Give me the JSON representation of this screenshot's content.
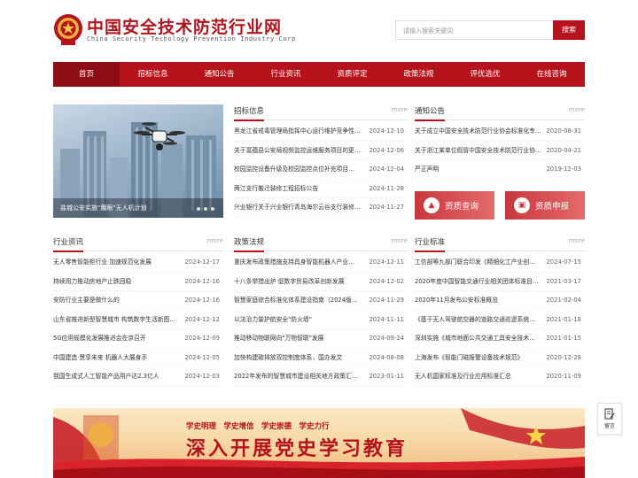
{
  "header": {
    "site_name": "中国安全技术防范行业网",
    "site_name_en": "China Security Techology Prevention Industry Corp",
    "search_placeholder": "请输入搜索关键词",
    "search_button": "搜索"
  },
  "nav": {
    "items": [
      "首页",
      "招标信息",
      "通知公告",
      "行业资讯",
      "资质评定",
      "政策法规",
      "评优选优",
      "在线咨询"
    ]
  },
  "hero": {
    "caption": "盐城公安实施\"鹰眼\"无人机计划"
  },
  "tender": {
    "title": "招标信息",
    "more": "more",
    "items": [
      {
        "title": "黑龙江省戒毒管理局指挥中心运行维护竞争性…",
        "date": "2024-12-10"
      },
      {
        "title": "关于富蕴县公安局视频监控运维服务项目的更…",
        "date": "2024-12-06"
      },
      {
        "title": "校园监控设备升级及校园监控点位补充项目…",
        "date": "2024-12-04"
      },
      {
        "title": "两江支行搬迁装修工程招标公告",
        "date": "2024-11-28"
      },
      {
        "title": "兴业银行关于兴业银行青岛海尔云谷支行装修…",
        "date": "2024-11-27"
      }
    ]
  },
  "notice": {
    "title": "通知公告",
    "more": "more",
    "items": [
      {
        "title": "关于成立中国安全技术防范行业协会标准化专…",
        "date": "2020-08-31"
      },
      {
        "title": "关于浙江某单位假冒中国安全技术防范行业协…",
        "date": "2020-04-21"
      },
      {
        "title": "严正声明",
        "date": "2019-12-03"
      }
    ]
  },
  "qualification": {
    "query": "资质查询",
    "apply": "资质申报"
  },
  "industry": {
    "title": "行业资讯",
    "more": "more",
    "items": [
      {
        "title": "无人零售智能柜行业 加速规范化发展",
        "date": "2024-12-17"
      },
      {
        "title": "持续用力推动房地产止跌回稳",
        "date": "2024-12-16"
      },
      {
        "title": "安防行业主要是做什么的",
        "date": "2024-12-16"
      },
      {
        "title": "山东省推进新型智慧城市 构筑数字生活新图…",
        "date": "2024-12-12"
      },
      {
        "title": "5G应用规模化发展推进会在京召开",
        "date": "2024-12-09"
      },
      {
        "title": "中国建造·慧享未来 机器人大展身手",
        "date": "2024-12-05"
      },
      {
        "title": "我国生成式人工智能产品用户达2.3亿人",
        "date": "2024-12-03"
      }
    ]
  },
  "policy": {
    "title": "政策法规",
    "more": "more",
    "items": [
      {
        "title": "重庆发布政策措施支持具身智能机器人产业…",
        "date": "2024-12-11"
      },
      {
        "title": "十八条举措出炉 促数字贸易改革创新发展",
        "date": "2024-12-02"
      },
      {
        "title": "智慧家庭综合标准化体系建设指南（2024版…",
        "date": "2024-11-29"
      },
      {
        "title": "以法治力量护航安全\"防火墙\"",
        "date": "2024-11-11"
      },
      {
        "title": "推动移动物联网向\"万物智联\"发展",
        "date": "2024-09-24"
      },
      {
        "title": "加快构建碳排放双控制度体系，国办发文",
        "date": "2024-08-08"
      },
      {
        "title": "2022年发布的智慧城市建设相关地方政策汇…",
        "date": "2023-01-11"
      }
    ]
  },
  "standards": {
    "title": "行业标准",
    "more": "more",
    "items": [
      {
        "title": "工信部等九部门联合印发《精细化工产业创…",
        "date": "2024-07-15"
      },
      {
        "title": "2020年度中国智能交通行业相关团体标准目…",
        "date": "2021-03-17"
      },
      {
        "title": "2020年11月发布公安标准概览",
        "date": "2021-02-04"
      },
      {
        "title": "《基于无人驾驶航空器的道路交通巡逻系统…",
        "date": "2021-01-18"
      },
      {
        "title": "深圳实施《城市地面公共交通工具安全技术…",
        "date": "2021-01-15"
      },
      {
        "title": "上海发布《智能门磁报警设备技术规范》",
        "date": "2020-12-28"
      },
      {
        "title": "无人机国家标准及行业应用标准汇总",
        "date": "2020-11-09"
      }
    ]
  },
  "banner": {
    "slogans": "学史明理　学史增信　学史崇德　学史力行",
    "main": "深入开展党史学习教育"
  },
  "side": {
    "label": "留言"
  },
  "colors": {
    "brand_red": "#b5121b",
    "nav_active": "#8e0d14"
  }
}
